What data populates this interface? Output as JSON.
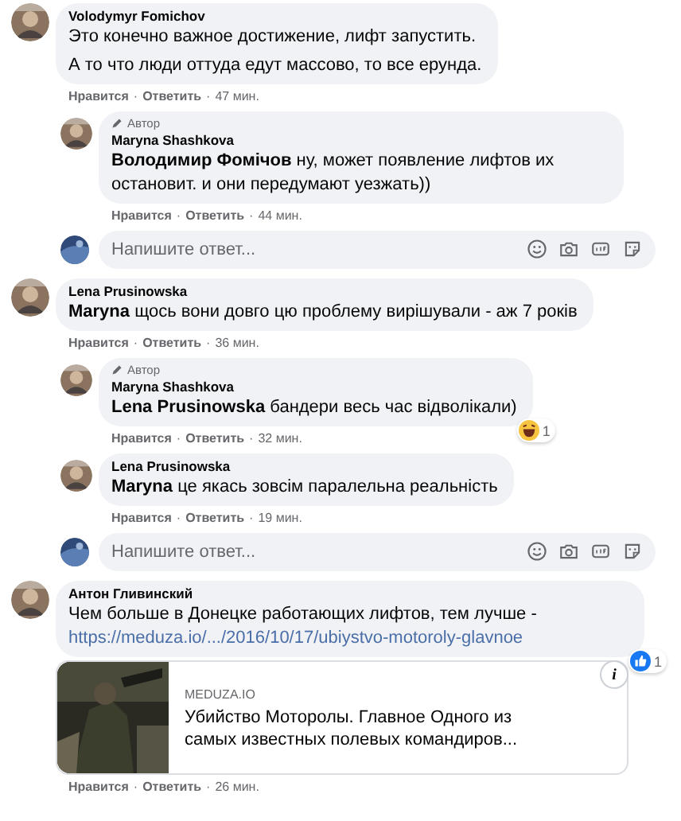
{
  "comments": [
    {
      "author": "Volodymyr Fomichov",
      "paragraphs": [
        "Это конечно важное достижение, лифт запустить.",
        "А то что люди оттуда едут массово, то все ерунда."
      ],
      "like_label": "Нравится",
      "reply_label": "Ответить",
      "separators": [
        "·",
        "·"
      ],
      "time": "47 мин.",
      "children": [
        {
          "author": "Maryna Shashkova",
          "author_badge": "Автор",
          "paragraphs": [
            "**Володимир Фомічов** ну, может появление лифтов их остановит. и они передумают уезжать))"
          ],
          "like_label": "Нравится",
          "reply_label": "Ответить",
          "separators": [
            "·",
            "·"
          ],
          "time": "44 мин."
        }
      ],
      "reply_box": {
        "placeholder": "Напишите ответ..."
      }
    },
    {
      "author": "Lena Prusinowska",
      "paragraphs": [
        "**Maryna** щось вони довго цю проблему вирішували - аж 7 років"
      ],
      "like_label": "Нравится",
      "reply_label": "Ответить",
      "separators": [
        "·",
        "·"
      ],
      "time": "36 мин.",
      "children": [
        {
          "author": "Maryna Shashkova",
          "author_badge": "Автор",
          "paragraphs": [
            "**Lena Prusinowska** бандери весь час відволікали)"
          ],
          "like_label": "Нравится",
          "reply_label": "Ответить",
          "separators": [
            "·",
            "·"
          ],
          "time": "32 мин.",
          "reaction": {
            "kind": "haha",
            "count": "1"
          }
        },
        {
          "author": "Lena Prusinowska",
          "paragraphs": [
            "**Maryna** це якась зовсім паралельна реальність"
          ],
          "like_label": "Нравится",
          "reply_label": "Ответить",
          "separators": [
            "·",
            "·"
          ],
          "time": "19 мин."
        }
      ],
      "reply_box": {
        "placeholder": "Напишите ответ..."
      }
    },
    {
      "author": "Антон Гливинский",
      "paragraphs": [
        "Чем больше в Донецке работающих лифтов, тем лучше -"
      ],
      "link": "https://meduza.io/.../2016/10/17/ubiystvo-motoroly-glavnoe",
      "preview": {
        "kind": "picture",
        "domain": "MEDUZA.IO",
        "title": "Убийство Моторолы. Главное Одного из самых известных полевых командиров...",
        "info_button": "i"
      },
      "like_label": "Нравится",
      "reply_label": "Ответить",
      "separators": [
        "·",
        "·"
      ],
      "time": "26 мин.",
      "reaction": {
        "kind": "like",
        "count": "1"
      }
    }
  ]
}
